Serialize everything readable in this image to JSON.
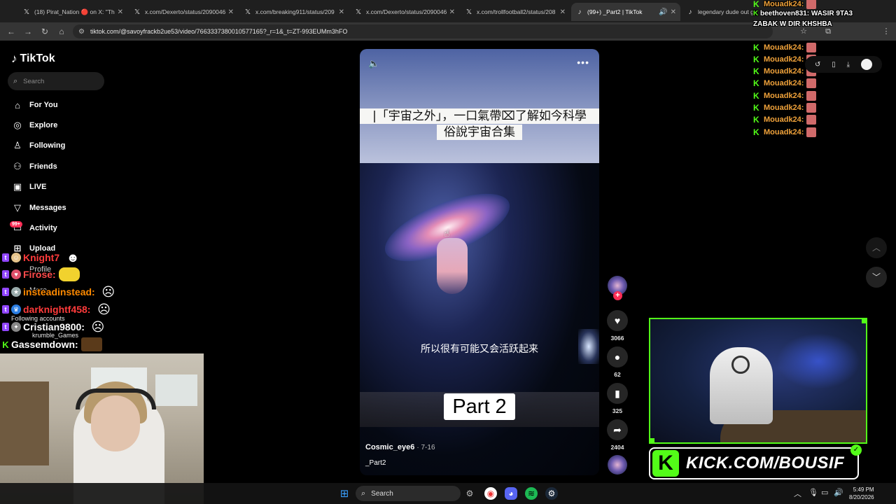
{
  "browser": {
    "tabs": [
      {
        "label": "(18) Pirat_Nation 🔴 on X: \"The",
        "icon": "x-logo-icon"
      },
      {
        "label": "x.com/Dexerto/status/2090046",
        "icon": "x-logo-icon"
      },
      {
        "label": "x.com/breaking911/status/209",
        "icon": "x-logo-icon"
      },
      {
        "label": "x.com/Dexerto/status/2090046",
        "icon": "x-logo-icon"
      },
      {
        "label": "x.com/trollfootball2/status/208",
        "icon": "x-logo-icon"
      },
      {
        "label": "(99+) _Part2 | TikTok",
        "icon": "tiktok-icon",
        "active": true
      },
      {
        "label": "legendary dude out ge",
        "icon": "tiktok-icon"
      }
    ],
    "url": "tiktok.com/@savoyfrackb2ue53/video/7663337380010577165?_r=1&_t=ZT-993EUMm3hFO"
  },
  "tiktok": {
    "logo": "TikTok",
    "search_placeholder": "Search",
    "nav": [
      {
        "label": "For You",
        "icon": "home-icon"
      },
      {
        "label": "Explore",
        "icon": "compass-icon"
      },
      {
        "label": "Following",
        "icon": "following-icon"
      },
      {
        "label": "Friends",
        "icon": "friends-icon"
      },
      {
        "label": "LIVE",
        "icon": "live-icon"
      },
      {
        "label": "Messages",
        "icon": "messages-icon"
      },
      {
        "label": "Activity",
        "icon": "activity-icon"
      },
      {
        "label": "Upload",
        "icon": "upload-icon"
      }
    ],
    "activity_badge": "99+",
    "profile_label": "Profile",
    "more_label": "More",
    "following_accounts_label": "Following accounts",
    "following_account_name": "krumble_Games",
    "video": {
      "title_line1": "|「宇宙之外」，一口氣帶⌧了解如今科學",
      "title_line2": "俗說宇宙合集",
      "subtitle": "所以很有可能又会活跃起来",
      "part_label": "Part 2",
      "author": "Cosmic_eye6",
      "date": "· 7-16",
      "description": "_Part2"
    },
    "actions": {
      "likes": "3066",
      "comments": "62",
      "saves": "325",
      "shares": "2404"
    }
  },
  "overlay_chat_left": [
    {
      "platform": "twitch",
      "name": "Knight7",
      "color": "#ff3b3b"
    },
    {
      "platform": "twitch",
      "name": "Firose:",
      "color": "#ff4b4b"
    },
    {
      "platform": "twitch",
      "name": "insteadinstead:",
      "color": "#ff8a00"
    },
    {
      "platform": "twitch",
      "name": "darknightf458:",
      "color": "#ff3b3b"
    },
    {
      "platform": "twitch",
      "name": "Cristian9800:",
      "color": "#ffffff"
    },
    {
      "platform": "kick",
      "name": "Gassemdown:",
      "color": "#ffffff"
    }
  ],
  "overlay_chat_right": {
    "top_user": "Mouadk24:",
    "message_user": "beethoven831:",
    "message_text_1": "WASIR 9TA3",
    "message_text_2": "ZABAK W DIR KHSHBA",
    "repeat_user": "Mouadk24:",
    "repeat_count": 8
  },
  "kick_banner": "KICK.COM/BOUSIF",
  "taskbar": {
    "search_placeholder": "Search",
    "time": "5:49 PM",
    "date": "8/20/2026"
  },
  "colors": {
    "tiktok_red": "#fe2c55",
    "kick_green": "#53fc18",
    "twitch_purple": "#9146ff"
  }
}
